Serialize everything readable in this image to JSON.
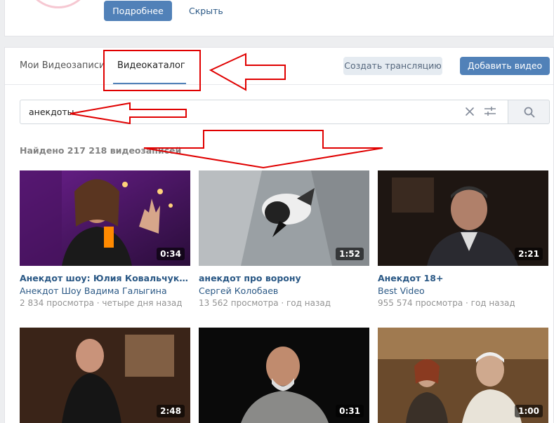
{
  "top": {
    "more_label": "Подробнее",
    "hide_label": "Скрыть"
  },
  "tabs": {
    "mine_label": "Мои Видеозаписи",
    "catalog_label": "Видеокаталог"
  },
  "actions": {
    "stream_label": "Создать трансляцию",
    "add_label": "Добавить видео"
  },
  "search": {
    "value": "анекдоты"
  },
  "results": {
    "found_label": "Найдено 217 218 видеозаписей"
  },
  "videos": [
    {
      "title": "Анекдот шоу: Юлия Ковальчук - изобретательная жена",
      "author": "Анекдот Шоу Вадима Галыгина",
      "meta": "2 834 просмотра · четыре дня назад",
      "duration": "0:34"
    },
    {
      "title": "анекдот про ворону",
      "author": "Сергей Колобаев",
      "meta": "13 562 просмотра · год назад",
      "duration": "1:52"
    },
    {
      "title": "Анекдот 18+",
      "author": "Best Video",
      "meta": "955 574 просмотра · год назад",
      "duration": "2:21"
    },
    {
      "title": "",
      "author": "",
      "meta": "",
      "duration": "2:48"
    },
    {
      "title": "",
      "author": "",
      "meta": "",
      "duration": "0:31"
    },
    {
      "title": "",
      "author": "",
      "meta": "",
      "duration": "1:00"
    }
  ],
  "colors": {
    "accent": "#5181b8",
    "link": "#2a5885",
    "annotation": "#e00000"
  }
}
